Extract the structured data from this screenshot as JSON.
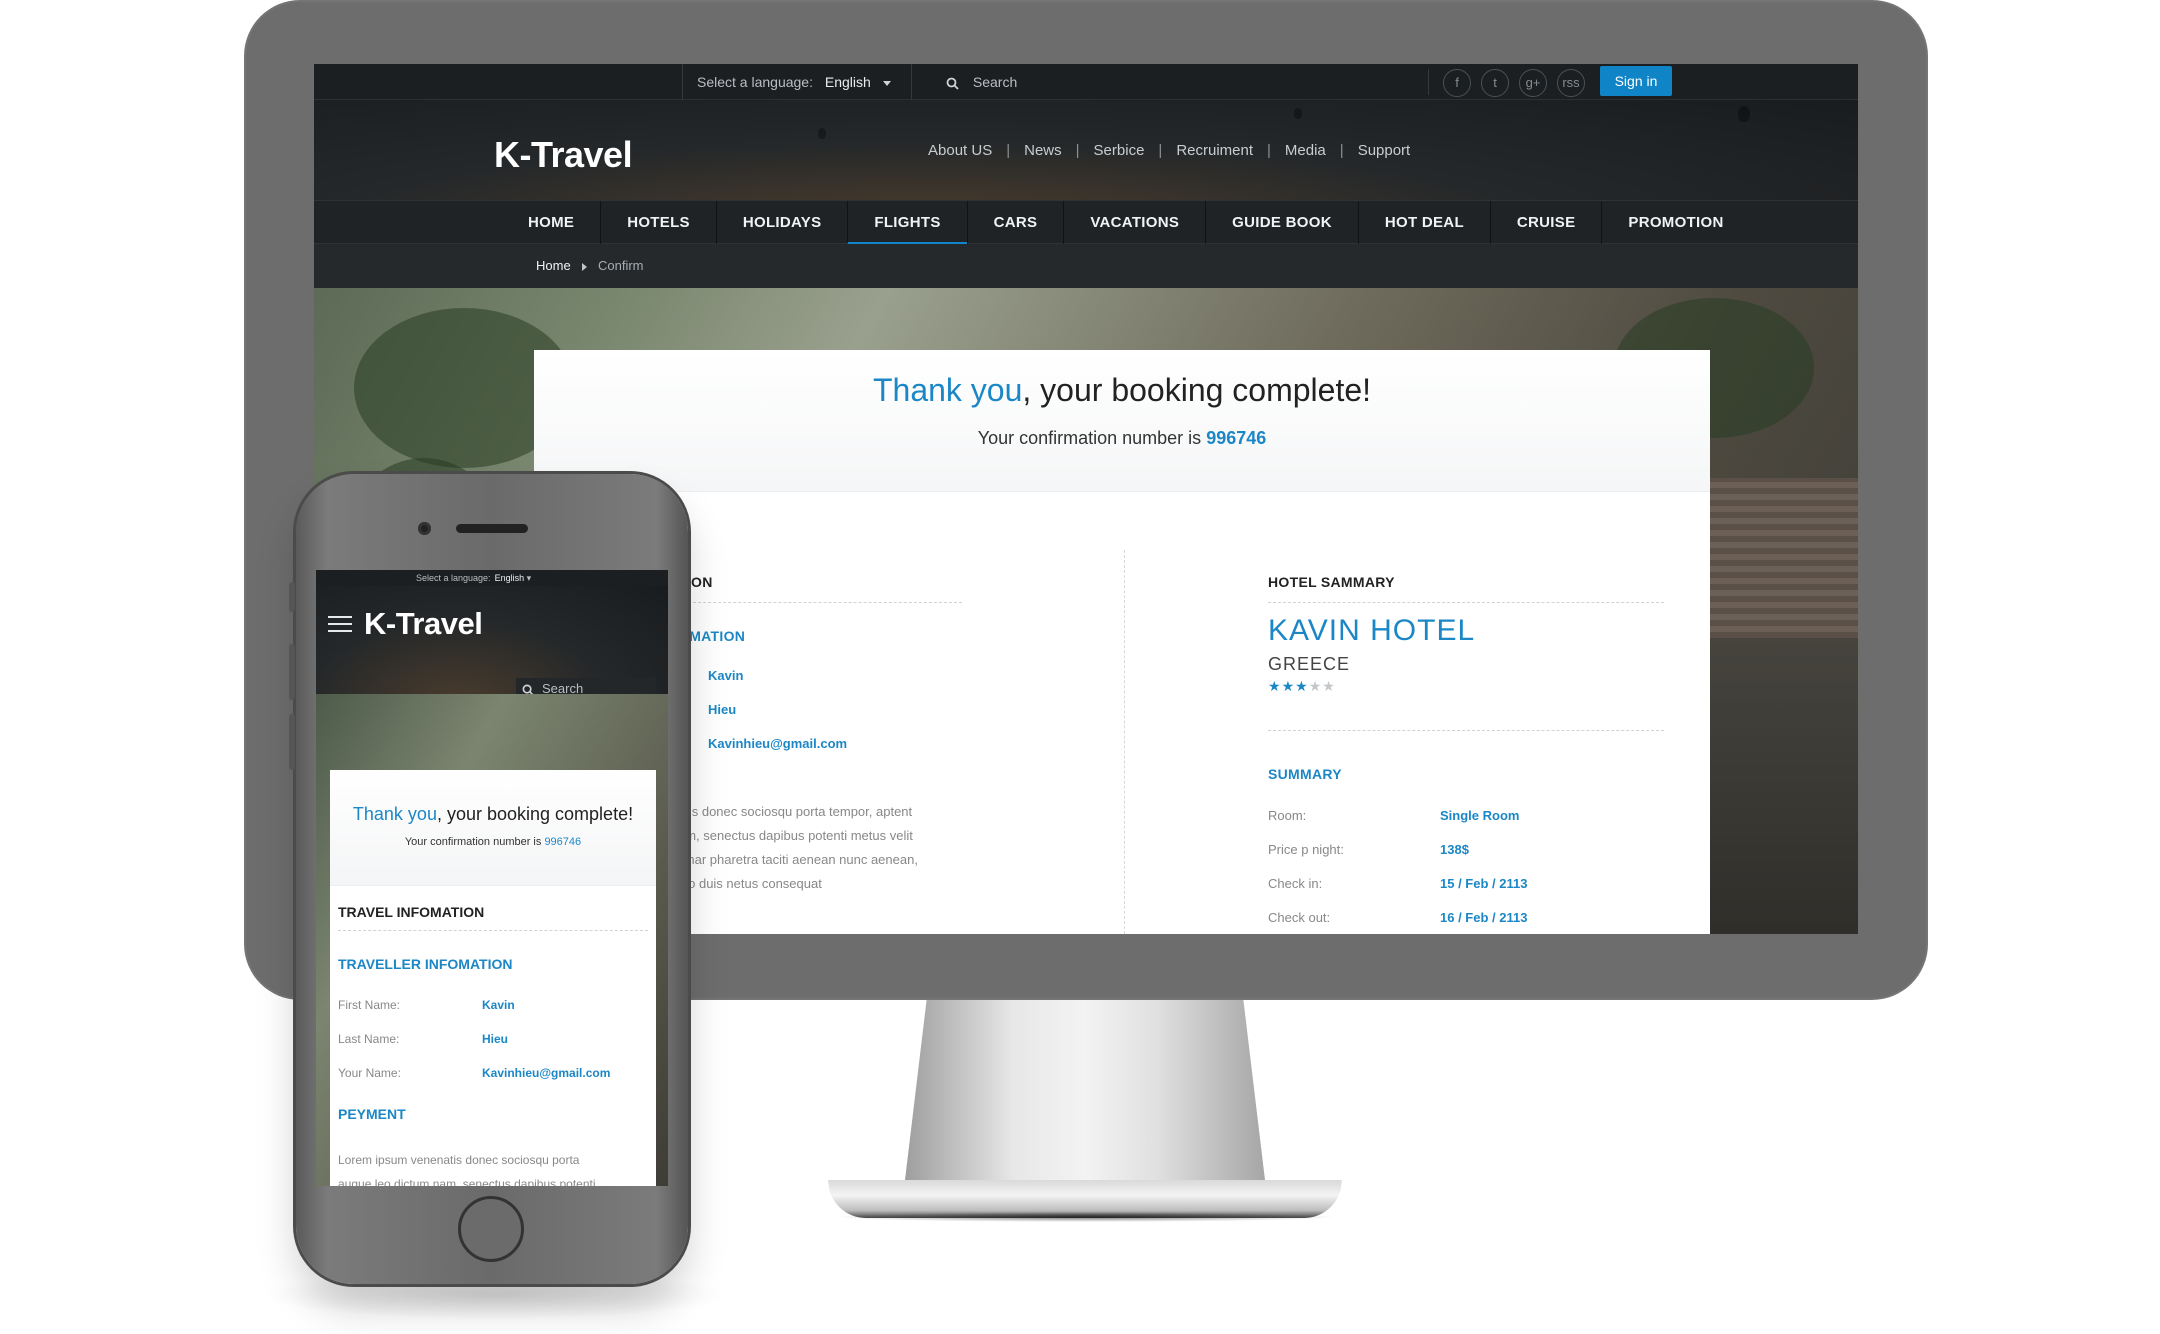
{
  "desktop": {
    "utilbar": {
      "language_label": "Select a language:",
      "language_value": "English",
      "search_placeholder": "Search",
      "social": [
        "f",
        "t",
        "g+",
        "rss"
      ],
      "signin_label": "Sign in"
    },
    "header": {
      "logo": "K-Travel",
      "top_links": [
        "About US",
        "News",
        "Serbice",
        "Recruiment",
        "Media",
        "Support"
      ]
    },
    "menu": {
      "items": [
        "HOME",
        "HOTELS",
        "HOLIDAYS",
        "FLIGHTS",
        "CARS",
        "VACATIONS",
        "GUIDE BOOK",
        "HOT DEAL",
        "CRUISE",
        "PROMOTION"
      ],
      "active": "FLIGHTS"
    },
    "breadcrumb": {
      "home": "Home",
      "current": "Confirm"
    },
    "card": {
      "thanks_highlight": "Thank you",
      "thanks_rest": ", your booking complete!",
      "confirm_prefix": "Your confirmation number is ",
      "confirm_number": "996746",
      "left": {
        "section_title_partial": "TION",
        "sub_title_partial": "OMATION",
        "values": [
          "Kavin",
          "Hieu",
          "Kavinhieu@gmail.com"
        ],
        "para_lines": [
          "atis donec sociosqu porta tempor, aptent",
          "am, senectus dapibus potenti metus velit",
          "vinar pharetra taciti aenean nunc aenean,",
          "leo duis netus consequat"
        ]
      },
      "right": {
        "section_title": "HOTEL SAMMARY",
        "hotel_name": "KAVIN HOTEL",
        "hotel_country": "GREECE",
        "rating": 3,
        "rating_max": 5,
        "summary_title": "SUMMARY",
        "summary": [
          {
            "label": "Room:",
            "value": "Single Room"
          },
          {
            "label": "Price p night:",
            "value": "138$"
          },
          {
            "label": "Check in:",
            "value": "15 / Feb / 2113"
          },
          {
            "label": "Check out:",
            "value": "16 / Feb / 2113"
          }
        ]
      }
    }
  },
  "mobile": {
    "language_label": "Select a language:",
    "language_value": "English",
    "logo": "K-Travel",
    "search_placeholder": "Search",
    "thanks_highlight": "Thank you",
    "thanks_rest": ", your booking complete!",
    "confirm_prefix": "Your confirmation number is ",
    "confirm_number": "996746",
    "travel_title": "TRAVEL INFOMATION",
    "traveller_title": "TRAVELLER INFOMATION",
    "traveller": [
      {
        "label": "First Name:",
        "value": "Kavin"
      },
      {
        "label": "Last Name:",
        "value": "Hieu"
      },
      {
        "label": "Your Name:",
        "value": "Kavinhieu@gmail.com"
      }
    ],
    "payment_title": "PEYMENT",
    "payment_text": "Lorem ipsum venenatis donec sociosqu porta",
    "payment_text_line2": "augue leo dictum nam, senectus dapibus potenti"
  },
  "colors": {
    "accent": "#1c87c6",
    "signin": "#0f84c7",
    "device_frame": "#6d6d6d"
  }
}
